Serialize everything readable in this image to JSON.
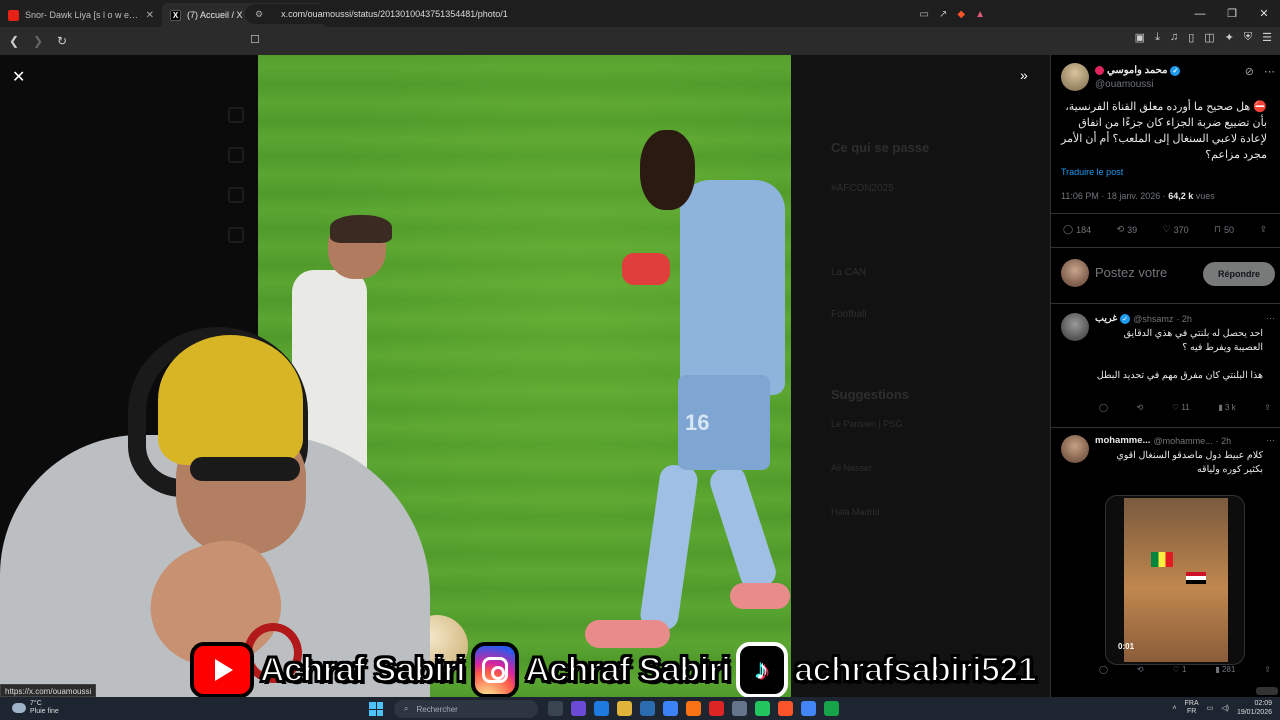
{
  "browser": {
    "tabs": [
      {
        "title": "Snor- Dawk Liya [s l o w e d + reve",
        "favicon": "youtube"
      },
      {
        "title": "(7) Accueil / X",
        "favicon": "x"
      }
    ],
    "url": "x.com/ouamoussi/status/2013010043751354481/photo/1",
    "status_url": "https://x.com/ouamoussi"
  },
  "media": {
    "dimmed_sidebar": {
      "trending_title": "Ce qui se passe",
      "hashtag": "#AFCON2025",
      "section2": "La CAN",
      "section3": "Football",
      "suggestions_title": "Suggestions",
      "suggestion1": "Le Parisien | PSG",
      "suggestion2": "Ali Nasser",
      "suggestion3": "Hala Madrid"
    },
    "jersey_number": "16"
  },
  "banner": {
    "youtube_name": "Achraf Sabiri",
    "instagram_name": "Achraf Sabiri",
    "tiktok_name": "achrafsabiri521"
  },
  "tweet": {
    "author_name": "محمد واموسي",
    "author_handle": "@ouamoussi",
    "text": "⛔ هل صحيح ما أورده معلق القناة الفرنسية، بأن تضييع ضربة الجزاء كان جزءًا من اتفاق لإعادة لاعبي السنغال إلى الملعب؟ أم أن الأمر مجرد مزاعم؟",
    "translate_label": "Traduire le post",
    "time": "11:06 PM · 18 janv. 2026 · ",
    "views_count": "64,2 k",
    "views_label": " vues",
    "stats": {
      "replies": "184",
      "reposts": "39",
      "likes": "370",
      "bookmarks": "50"
    },
    "reply_placeholder": "Postez votre",
    "reply_button": "Répondre"
  },
  "replies": [
    {
      "name": "غريب",
      "handle": "@shsamz",
      "age": "· 2h",
      "text1": "احد يحصل له بلنتي في هذي الدقايق العصيبة ويفرط فيه ؟",
      "text2": "هذا البلنتي كان مفرق مهم في تحديد البطل",
      "stats": {
        "replies": "",
        "reposts": "",
        "likes": "11",
        "views": "3 k"
      }
    },
    {
      "name": "mohamme...",
      "handle": "@mohamme...",
      "age": "· 2h",
      "text1": "كلام عبيط دول ماصدقو السنغال اقوي بكثير كوره ولياقه",
      "video_time": "0:01",
      "stats": {
        "replies": "",
        "reposts": "",
        "likes": "1",
        "views": "281"
      }
    }
  ],
  "taskbar": {
    "weather_temp": "7°C",
    "weather_desc": "Pluie fine",
    "search_placeholder": "Rechercher",
    "lang": "FRA",
    "lang_sub": "FR",
    "time": "02:09",
    "date": "19/01/2026"
  },
  "colors": {
    "accent": "#1d9bf0",
    "background": "#000000",
    "pitch": "#5ba632"
  }
}
